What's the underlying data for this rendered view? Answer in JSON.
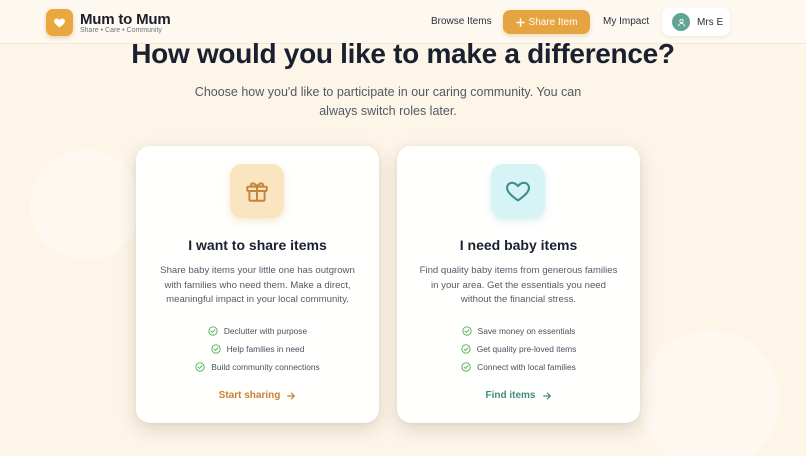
{
  "colors": {
    "brand": "#e9a73e",
    "teal": "#3e8d80",
    "check": "#4caf50",
    "background": "#fdf5e8"
  },
  "header": {
    "brand_name": "Mum to Mum",
    "tagline": "Share • Care • Community",
    "logo_icon": "heart-icon",
    "nav": {
      "browse": "Browse Items",
      "share": "Share Item",
      "share_icon": "plus-icon",
      "impact": "My Impact"
    },
    "user": {
      "name": "Mrs E",
      "avatar_icon": "user-icon"
    }
  },
  "main": {
    "title": "How would you like to make a difference?",
    "subtitle": "Choose how you'd like to participate in our caring community. You can always switch roles later."
  },
  "cards": [
    {
      "icon": "gift-icon",
      "title": "I want to share items",
      "description": "Share baby items your little one has outgrown with families who need them. Make a direct, meaningful impact in your local community.",
      "features": [
        "Declutter with purpose",
        "Help families in need",
        "Build community connections"
      ],
      "cta": "Start sharing",
      "accent": "#cc7f30"
    },
    {
      "icon": "heart-icon",
      "title": "I need baby items",
      "description": "Find quality baby items from generous families in your area. Get the essentials you need without the financial stress.",
      "features": [
        "Save money on essentials",
        "Get quality pre-loved items",
        "Connect with local families"
      ],
      "cta": "Find items",
      "accent": "#3e8d80"
    }
  ]
}
